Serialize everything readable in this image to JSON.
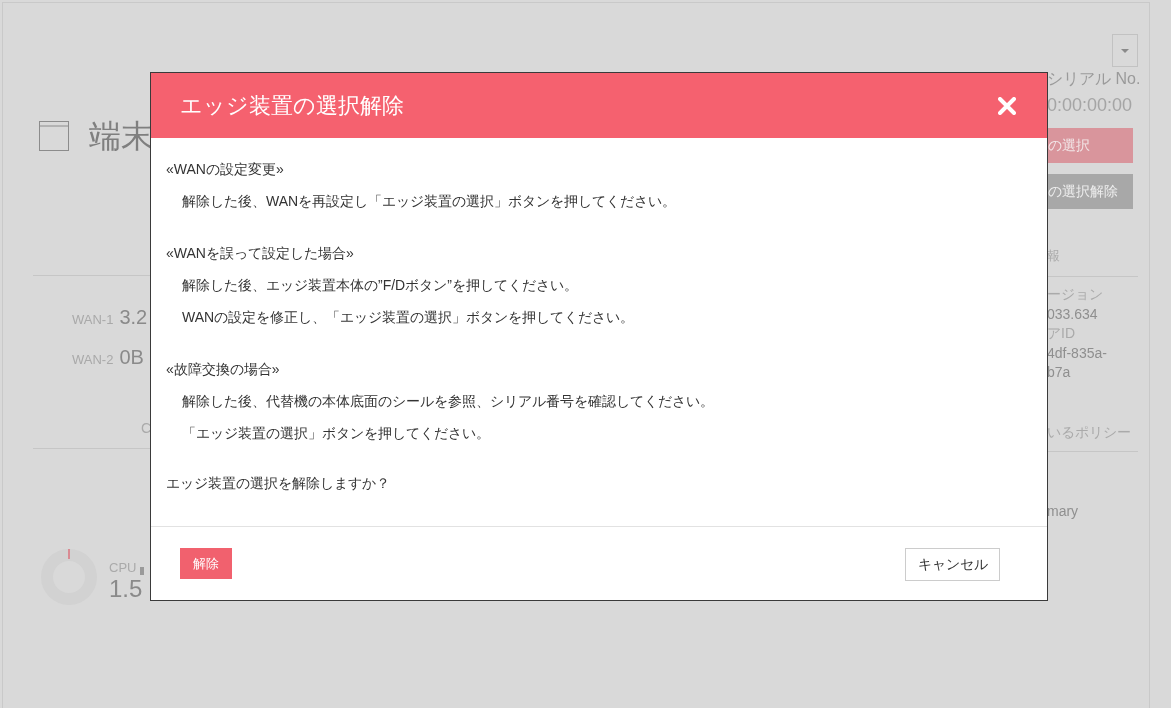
{
  "background": {
    "left": {
      "title": "端末",
      "wan": [
        {
          "label": "WAN-1",
          "value": "3.2"
        },
        {
          "label": "WAN-2",
          "value": "0B"
        }
      ],
      "column_fragment": "C",
      "cpu": {
        "label": "CPU",
        "value": "1.5"
      }
    },
    "right": {
      "serial_label": "シリアル No.",
      "serial_value": "0:00:00:00",
      "buttons": [
        {
          "label": "の選択",
          "kind": "primary"
        },
        {
          "label": "の選択解除",
          "kind": "secondary"
        }
      ],
      "info_heading": "報",
      "info_lines": [
        "ージョン",
        "033.634",
        "アID",
        "4df-835a-",
        "b7a"
      ],
      "policy_heading": "いるポリシー",
      "policy_value": "mary"
    }
  },
  "dialog": {
    "title": "エッジ装置の選択解除",
    "sections": [
      {
        "heading": "«WANの設定変更»",
        "lines": [
          "解除した後、WANを再設定し「エッジ装置の選択」ボタンを押してください。"
        ]
      },
      {
        "heading": "«WANを誤って設定した場合»",
        "lines": [
          "解除した後、エッジ装置本体の”F/Dボタン”を押してください。",
          "WANの設定を修正し、「エッジ装置の選択」ボタンを押してください。"
        ]
      },
      {
        "heading": "«故障交換の場合»",
        "lines": [
          "解除した後、代替機の本体底面のシールを参照、シリアル番号を確認してください。",
          "「エッジ装置の選択」ボタンを押してください。"
        ]
      }
    ],
    "question": "エッジ装置の選択を解除しますか？",
    "confirm": "解除",
    "cancel": "キャンセル"
  }
}
